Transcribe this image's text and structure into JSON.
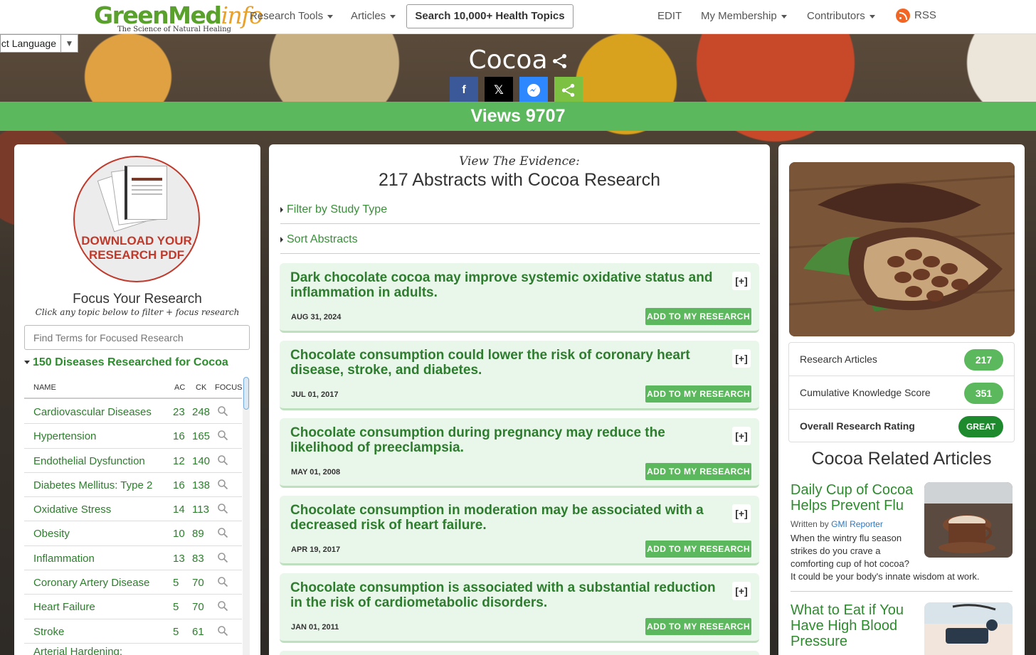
{
  "header": {
    "logo_main": "GreenMed",
    "logo_accent": "info",
    "logo_tagline": "The Science of Natural Healing",
    "nav": [
      {
        "label": "Research Tools",
        "dropdown": true
      },
      {
        "label": "Articles",
        "dropdown": true
      },
      {
        "label": "EDIT",
        "dropdown": false
      },
      {
        "label": "My Membership",
        "dropdown": true
      },
      {
        "label": "Contributors",
        "dropdown": true
      },
      {
        "label": "RSS",
        "dropdown": false,
        "icon": "rss-icon"
      }
    ],
    "search_label": "Search 10,000+ Health Topics"
  },
  "language": {
    "label": "Select Language"
  },
  "hero": {
    "title": "Cocoa",
    "social": [
      {
        "name": "facebook",
        "glyph": "f",
        "color": "#3b5998"
      },
      {
        "name": "x",
        "glyph": "X",
        "color": "#000000"
      },
      {
        "name": "messenger",
        "glyph": "m",
        "color": "#2d88ff"
      },
      {
        "name": "share",
        "glyph": "share",
        "color": "#7cc142"
      }
    ],
    "views": "Views 9707"
  },
  "left": {
    "download_label": "DOWNLOAD YOUR RESEARCH PDF",
    "download_line1": "DOWNLOAD YOUR",
    "download_line2": "RESEARCH PDF",
    "focus_title": "Focus Your Research",
    "focus_sub": "Click any topic below to filter + focus research",
    "search_placeholder": "Find Terms for Focused Research",
    "diseases_heading": "150 Diseases Researched for Cocoa",
    "table_headers": {
      "name": "NAME",
      "ac": "AC",
      "ck": "CK",
      "focus": "FOCUS"
    },
    "rows": [
      {
        "name": "Cardiovascular Diseases",
        "ac": "23",
        "ck": "248"
      },
      {
        "name": "Hypertension",
        "ac": "16",
        "ck": "165"
      },
      {
        "name": "Endothelial Dysfunction",
        "ac": "12",
        "ck": "140"
      },
      {
        "name": "Diabetes Mellitus: Type 2",
        "ac": "16",
        "ck": "138"
      },
      {
        "name": "Oxidative Stress",
        "ac": "14",
        "ck": "113"
      },
      {
        "name": "Obesity",
        "ac": "10",
        "ck": "89"
      },
      {
        "name": "Inflammation",
        "ac": "13",
        "ck": "83"
      },
      {
        "name": "Coronary Artery Disease",
        "ac": "5",
        "ck": "70"
      },
      {
        "name": "Heart Failure",
        "ac": "5",
        "ck": "70"
      },
      {
        "name": "Stroke",
        "ac": "5",
        "ck": "61"
      },
      {
        "name": "Arterial Hardening:",
        "ac": "",
        "ck": ""
      }
    ]
  },
  "main": {
    "view_evidence": "View The Evidence:",
    "abstracts_title": "217 Abstracts with Cocoa Research",
    "filter_label": "Filter by Study Type",
    "sort_label": "Sort Abstracts",
    "add_label": "ADD TO MY RESEARCH",
    "expand_label": "[+]",
    "abstracts": [
      {
        "title": "Dark chocolate cocoa may improve systemic oxidative status and inflammation in adults.",
        "date": "AUG 31, 2024"
      },
      {
        "title": "Chocolate consumption could lower the risk of coronary heart disease, stroke, and diabetes.",
        "date": "JUL 01, 2017"
      },
      {
        "title": "Chocolate consumption during pregnancy may reduce the likelihood of preeclampsia.",
        "date": "MAY 01, 2008"
      },
      {
        "title": "Chocolate consumption in moderation may be associated with a decreased risk of heart failure.",
        "date": "APR 19, 2017"
      },
      {
        "title": "Chocolate consumption is associated with a substantial reduction in the risk of cardiometabolic disorders.",
        "date": "JAN 01, 2011"
      }
    ]
  },
  "right": {
    "stats": [
      {
        "label": "Research Articles",
        "value": "217"
      },
      {
        "label": "Cumulative Knowledge Score",
        "value": "351"
      },
      {
        "label": "Overall Research Rating",
        "value": "GREAT"
      }
    ],
    "related_title": "Cocoa Related Articles",
    "articles": [
      {
        "title": "Daily Cup of Cocoa Helps Prevent Flu",
        "by_prefix": "Written by",
        "author": "GMI Reporter",
        "desc": "When the wintry flu season strikes do you crave a comforting cup of hot cocoa?",
        "desc2": "It could be your body's innate wisdom at work."
      },
      {
        "title": "What to Eat if You Have High Blood Pressure"
      }
    ]
  },
  "colors": {
    "brand_green": "#5cb85c",
    "dark_green": "#2e7d2e",
    "download_red": "#c0392b",
    "rss_orange": "#f26522"
  }
}
